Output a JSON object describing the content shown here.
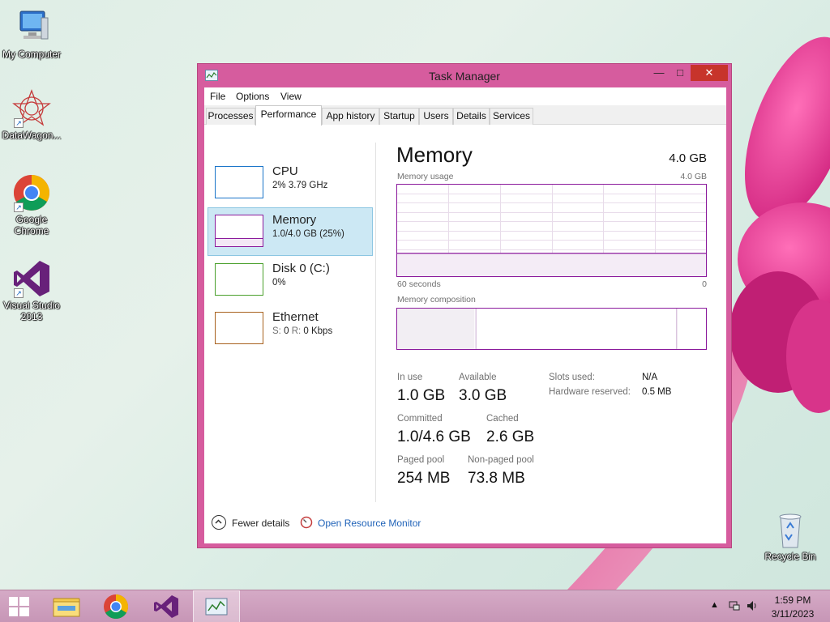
{
  "desktop": {
    "icons": [
      {
        "label": "My Computer"
      },
      {
        "label": "DataWagon..."
      },
      {
        "label": "Google Chrome"
      },
      {
        "label": "Visual Studio 2013"
      },
      {
        "label": "Recycle Bin"
      }
    ]
  },
  "window": {
    "title": "Task Manager",
    "menu": [
      "File",
      "Options",
      "View"
    ],
    "tabs": [
      "Processes",
      "Performance",
      "App history",
      "Startup",
      "Users",
      "Details",
      "Services"
    ],
    "active_tab": "Performance"
  },
  "sidebar": {
    "items": [
      {
        "name": "CPU",
        "detail": "2%  3.79 GHz",
        "color": "#1a75c9"
      },
      {
        "name": "Memory",
        "detail": "1.0/4.0 GB (25%)",
        "color": "#8b1a9c"
      },
      {
        "name": "Disk 0 (C:)",
        "detail": "0%",
        "color": "#4aa02c"
      },
      {
        "name": "Ethernet",
        "detail_s_label": "S:",
        "detail_s_val": "0",
        "detail_r_label": "R:",
        "detail_r_val": "0 Kbps",
        "color": "#a8611e"
      }
    ]
  },
  "memory": {
    "title": "Memory",
    "total": "4.0 GB",
    "usage_label": "Memory usage",
    "usage_max": "4.0 GB",
    "axis_left": "60 seconds",
    "axis_right": "0",
    "composition_label": "Memory composition",
    "usage_fraction": 0.25,
    "composition": {
      "in_use": 0.25,
      "modified": 0.005,
      "standby": 0.65,
      "free": 0.08
    },
    "stats": {
      "in_use_label": "In use",
      "in_use": "1.0 GB",
      "available_label": "Available",
      "available": "3.0 GB",
      "committed_label": "Committed",
      "committed": "1.0/4.6 GB",
      "cached_label": "Cached",
      "cached": "2.6 GB",
      "paged_label": "Paged pool",
      "paged": "254 MB",
      "nonpaged_label": "Non-paged pool",
      "nonpaged": "73.8 MB",
      "slots_label": "Slots used:",
      "slots": "N/A",
      "hw_label": "Hardware reserved:",
      "hw": "0.5 MB"
    }
  },
  "footer": {
    "fewer_details": "Fewer details",
    "resource_monitor": "Open Resource Monitor"
  },
  "taskbar": {
    "time": "1:59 PM",
    "date": "3/11/2023"
  },
  "colors": {
    "accent": "#d65c9e",
    "memory": "#8b1a9c",
    "selected": "#cce8f4",
    "link": "#1f62b8"
  }
}
